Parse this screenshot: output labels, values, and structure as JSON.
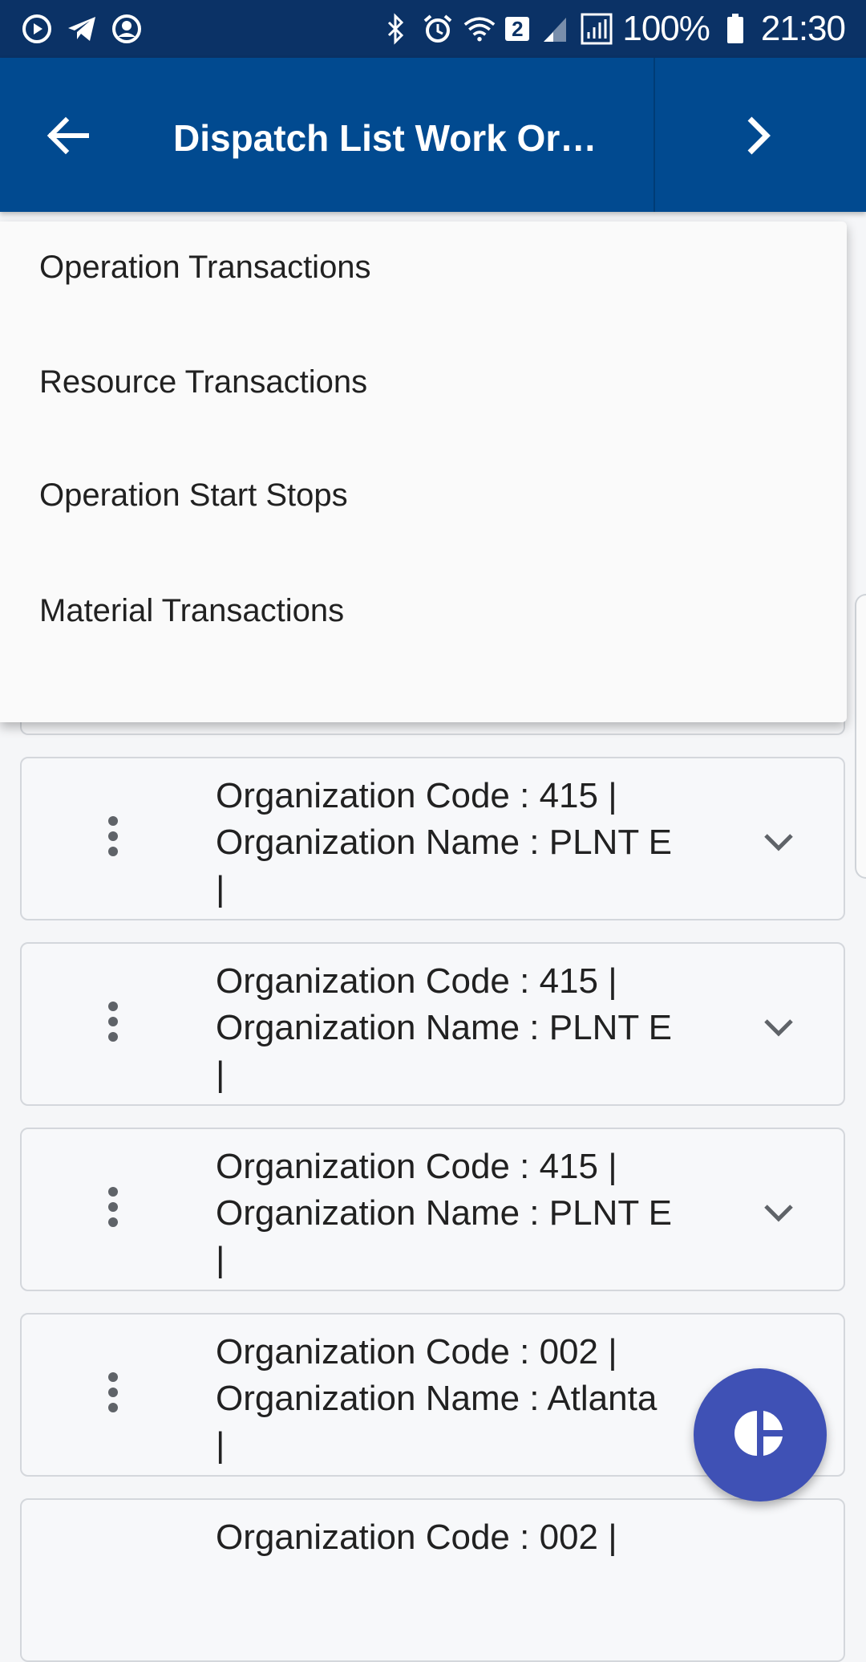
{
  "status_bar": {
    "battery_percent": "100%",
    "time": "21:30",
    "sim_badge": "2",
    "icons": [
      "play-circle-icon",
      "telegram-icon",
      "account-circle-icon",
      "bluetooth-icon",
      "alarm-icon",
      "wifi-icon",
      "signal-icon",
      "roaming-signal-icon",
      "battery-icon"
    ]
  },
  "app_bar": {
    "title": "Dispatch List Work Ord...",
    "back_icon": "arrow-back-icon",
    "forward_icon": "chevron-right-icon",
    "color": "#014a90"
  },
  "menu": {
    "items": [
      {
        "label": "Operation Transactions"
      },
      {
        "label": "Resource Transactions"
      },
      {
        "label": "Operation Start Stops"
      },
      {
        "label": "Material Transactions"
      }
    ]
  },
  "cards": [
    {
      "line1": "Organization Code : 415 |",
      "line2": "Organization Name : PLNT E",
      "line3": "|"
    },
    {
      "line1": "Organization Code : 415 |",
      "line2": "Organization Name : PLNT E",
      "line3": "|"
    },
    {
      "line1": "Organization Code : 415 |",
      "line2": "Organization Name : PLNT E",
      "line3": "|"
    },
    {
      "line1": "Organization Code : 002 |",
      "line2": "Organization Name : Atlanta",
      "line3": "|"
    },
    {
      "line1": "Organization Code : 002 |",
      "line2": "",
      "line3": ""
    }
  ],
  "fab": {
    "icon": "pie-chart-icon",
    "color": "#3f51b5"
  }
}
